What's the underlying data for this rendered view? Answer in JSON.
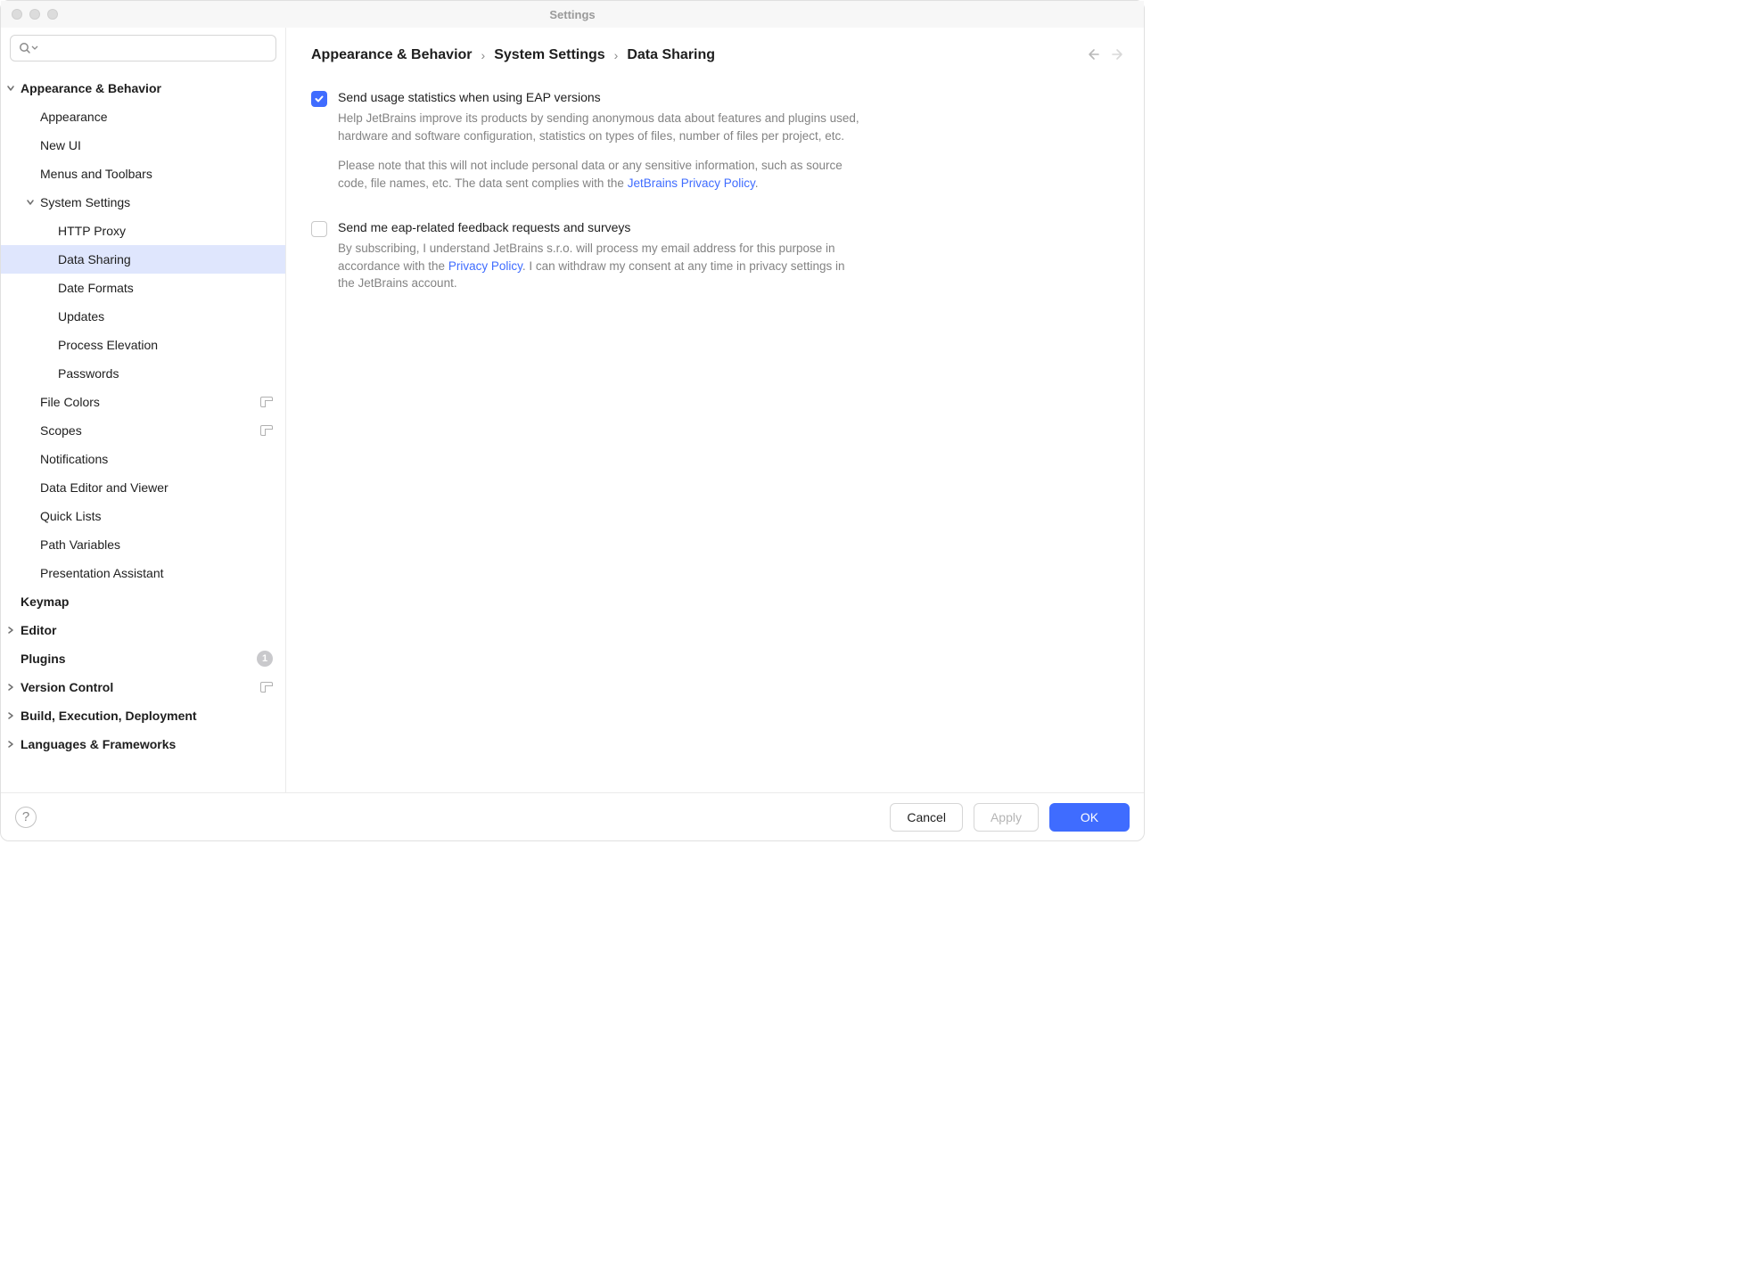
{
  "window": {
    "title": "Settings"
  },
  "breadcrumb": {
    "part1": "Appearance & Behavior",
    "part2": "System Settings",
    "part3": "Data Sharing"
  },
  "sidebar": {
    "items": {
      "appearance_behavior": "Appearance & Behavior",
      "appearance": "Appearance",
      "new_ui": "New UI",
      "menus_toolbars": "Menus and Toolbars",
      "system_settings": "System Settings",
      "http_proxy": "HTTP Proxy",
      "data_sharing": "Data Sharing",
      "date_formats": "Date Formats",
      "updates": "Updates",
      "process_elevation": "Process Elevation",
      "passwords": "Passwords",
      "file_colors": "File Colors",
      "scopes": "Scopes",
      "notifications": "Notifications",
      "data_editor": "Data Editor and Viewer",
      "quick_lists": "Quick Lists",
      "path_variables": "Path Variables",
      "presentation_assistant": "Presentation Assistant",
      "keymap": "Keymap",
      "editor": "Editor",
      "plugins": "Plugins",
      "plugins_count": "1",
      "version_control": "Version Control",
      "build": "Build, Execution, Deployment",
      "languages": "Languages & Frameworks"
    }
  },
  "settings": {
    "usage": {
      "title": "Send usage statistics when using EAP versions",
      "desc1": "Help JetBrains improve its products by sending anonymous data about features and plugins used, hardware and software configuration, statistics on types of files, number of files per project, etc.",
      "desc2_a": "Please note that this will not include personal data or any sensitive information, such as source code, file names, etc. The data sent complies with the ",
      "desc2_link": "JetBrains Privacy Policy",
      "desc2_b": "."
    },
    "feedback": {
      "title": "Send me eap-related feedback requests and surveys",
      "desc_a": "By subscribing, I understand JetBrains s.r.o. will process my email address for this purpose in accordance with the ",
      "desc_link": "Privacy Policy",
      "desc_b": ". I can withdraw my consent at any time in privacy settings in the JetBrains account."
    }
  },
  "footer": {
    "help": "?",
    "cancel": "Cancel",
    "apply": "Apply",
    "ok": "OK"
  }
}
